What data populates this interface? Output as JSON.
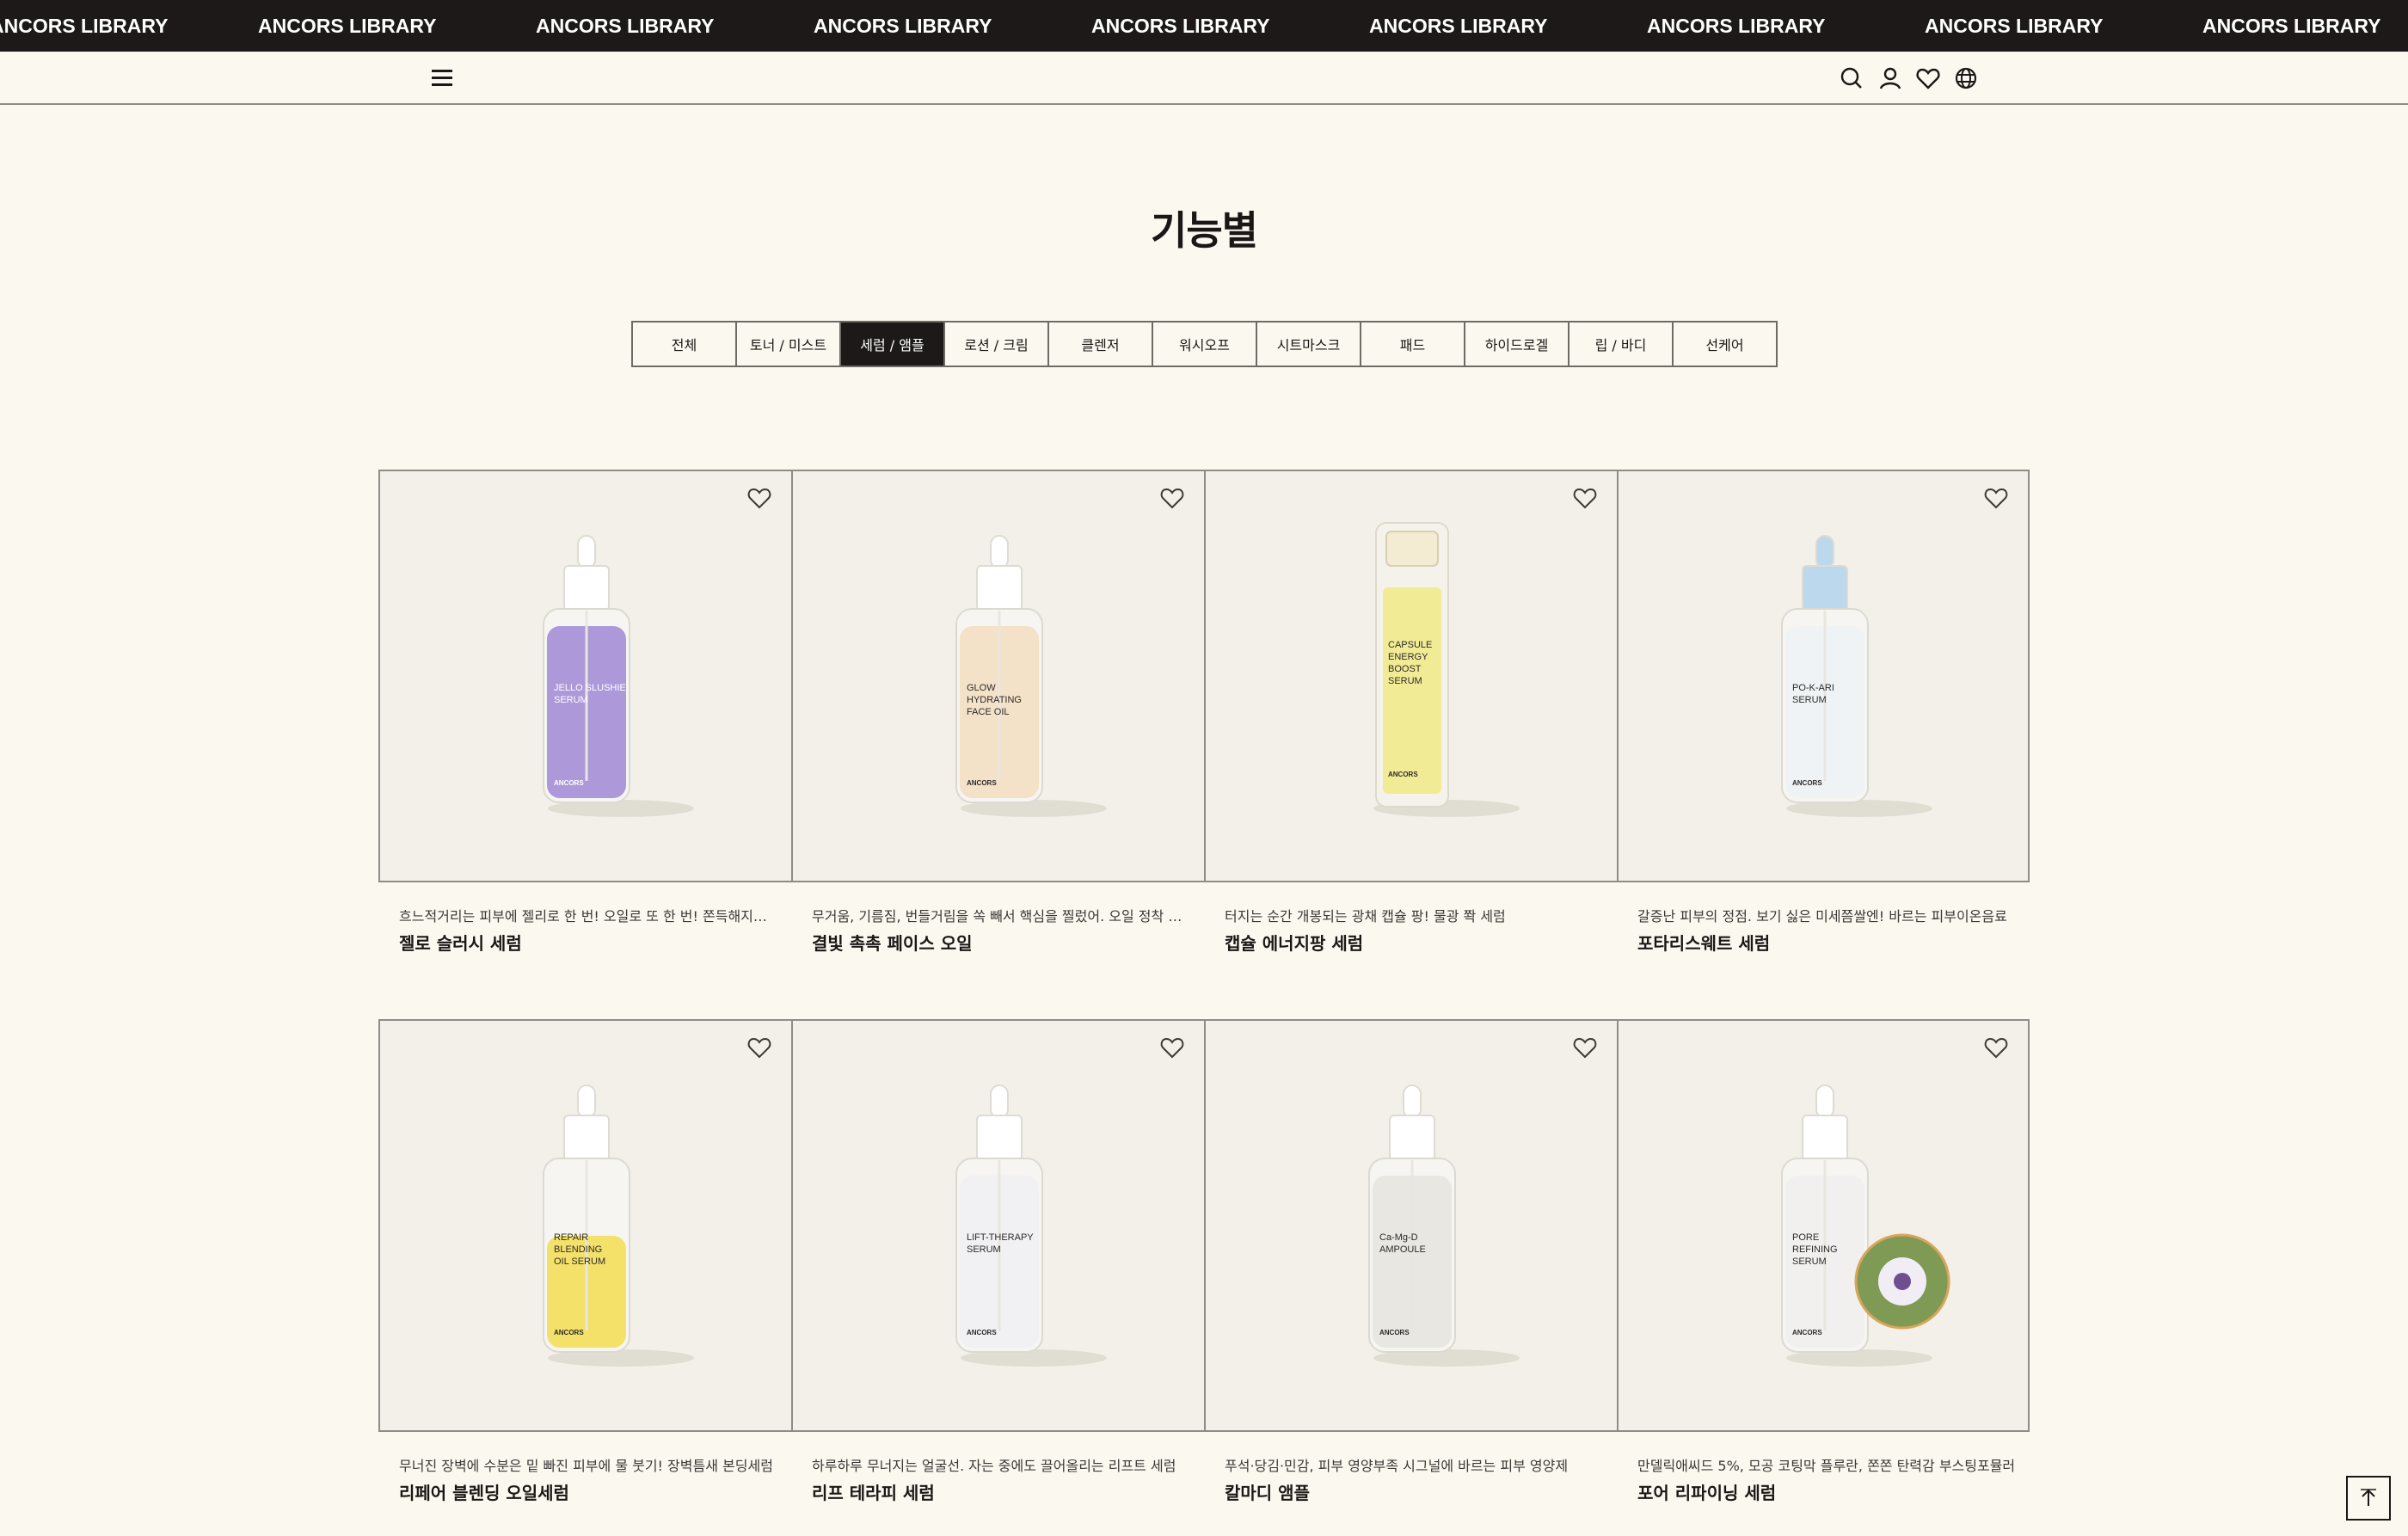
{
  "marquee": {
    "text": "ANCORS LIBRARY"
  },
  "page": {
    "title": "기능별"
  },
  "categories": [
    {
      "label": "전체"
    },
    {
      "label": "토너 / 미스트"
    },
    {
      "label": "세럼 / 앰플"
    },
    {
      "label": "로션 / 크림"
    },
    {
      "label": "클렌저"
    },
    {
      "label": "워시오프"
    },
    {
      "label": "시트마스크"
    },
    {
      "label": "패드"
    },
    {
      "label": "하이드로겔"
    },
    {
      "label": "립 / 바디"
    },
    {
      "label": "선케어"
    }
  ],
  "active_category": "세럼 / 앰플",
  "products": [
    {
      "desc": "흐느적거리는 피부에 젤리로 한 번! 오일로 또 한 번! 쫀득해지는 쿨…",
      "name": "젤로 슬러시 세럼",
      "label": [
        "JELLO SLUSHIE",
        "SERUM"
      ],
      "brand": "ANCORS",
      "liquid": "#a58fd6",
      "cap": "#ffffff",
      "icon": "heart-outline"
    },
    {
      "desc": "무거움, 기름짐, 번들거림을 쏙 빼서 핵심을 찔렀어. 오일 정착 성공템",
      "name": "결빛 촉촉 페이스 오일",
      "label": [
        "GLOW",
        "HYDRATING",
        "FACE OIL"
      ],
      "brand": "ANCORS",
      "liquid": "#f3dfc3",
      "cap": "#ffffff",
      "icon": "heart-outline"
    },
    {
      "desc": "터지는 순간 개봉되는 광채 캡슐 팡! 물광 쫙 세럼",
      "name": "캡슐 에너지팡 세럼",
      "label": [
        "CAPSULE",
        "ENERGY",
        "BOOST",
        "SERUM"
      ],
      "brand": "ANCORS",
      "liquid": "#f1ea86",
      "cap": "#f4ecd2",
      "icon": "heart-outline"
    },
    {
      "desc": "갈증난 피부의 정점. 보기 싫은 미세쯤쌀엔! 바르는 피부이온음료",
      "name": "포타리스웨트 세럼",
      "label": [
        "PO-K-ARI",
        "SERUM"
      ],
      "brand": "ANCORS",
      "liquid": "#eef3f6",
      "cap": "#bcd8ec",
      "icon": "heart-outline"
    },
    {
      "desc": "무너진 장벽에 수분은 밑 빠진 피부에 물 붓기! 장벽틈새 본딩세럼",
      "name": "리페어 블렌딩 오일세럼",
      "label": [
        "REPAIR",
        "BLENDING",
        "OIL SERUM"
      ],
      "brand": "ANCORS",
      "liquid": "#f4df5a",
      "cap": "#ffffff",
      "icon": "heart-outline"
    },
    {
      "desc": "하루하루 무너지는 얼굴선. 자는 중에도 끌어올리는 리프트 세럼",
      "name": "리프 테라피 세럼",
      "label": [
        "LIFT-THERAPY",
        "SERUM"
      ],
      "brand": "ANCORS",
      "liquid": "#f1f0f2",
      "cap": "#ffffff",
      "icon": "heart-outline"
    },
    {
      "desc": "푸석·당김·민감, 피부 영양부족 시그널에 바르는 피부 영양제",
      "name": "칼마디 앰플",
      "label": [
        "Ca-Mg-D",
        "AMPOULE"
      ],
      "brand": "ANCORS",
      "liquid": "#e8e6df",
      "cap": "#ffffff",
      "icon": "heart-outline"
    },
    {
      "desc": "만델릭애씨드 5%, 모공 코팅막 플루란, 쫀쫀 탄력감 부스팅포뮬러",
      "name": "포어 리파이닝 세럼",
      "label": [
        "PORE",
        "REFINING",
        "SERUM"
      ],
      "brand": "ANCORS",
      "liquid": "#f1f0ee",
      "cap": "#ffffff",
      "icon": "heart-outline"
    }
  ],
  "colors": {
    "background": "#fbf9ef",
    "dark": "#1c1918",
    "thumb": "#f2f0e8"
  }
}
